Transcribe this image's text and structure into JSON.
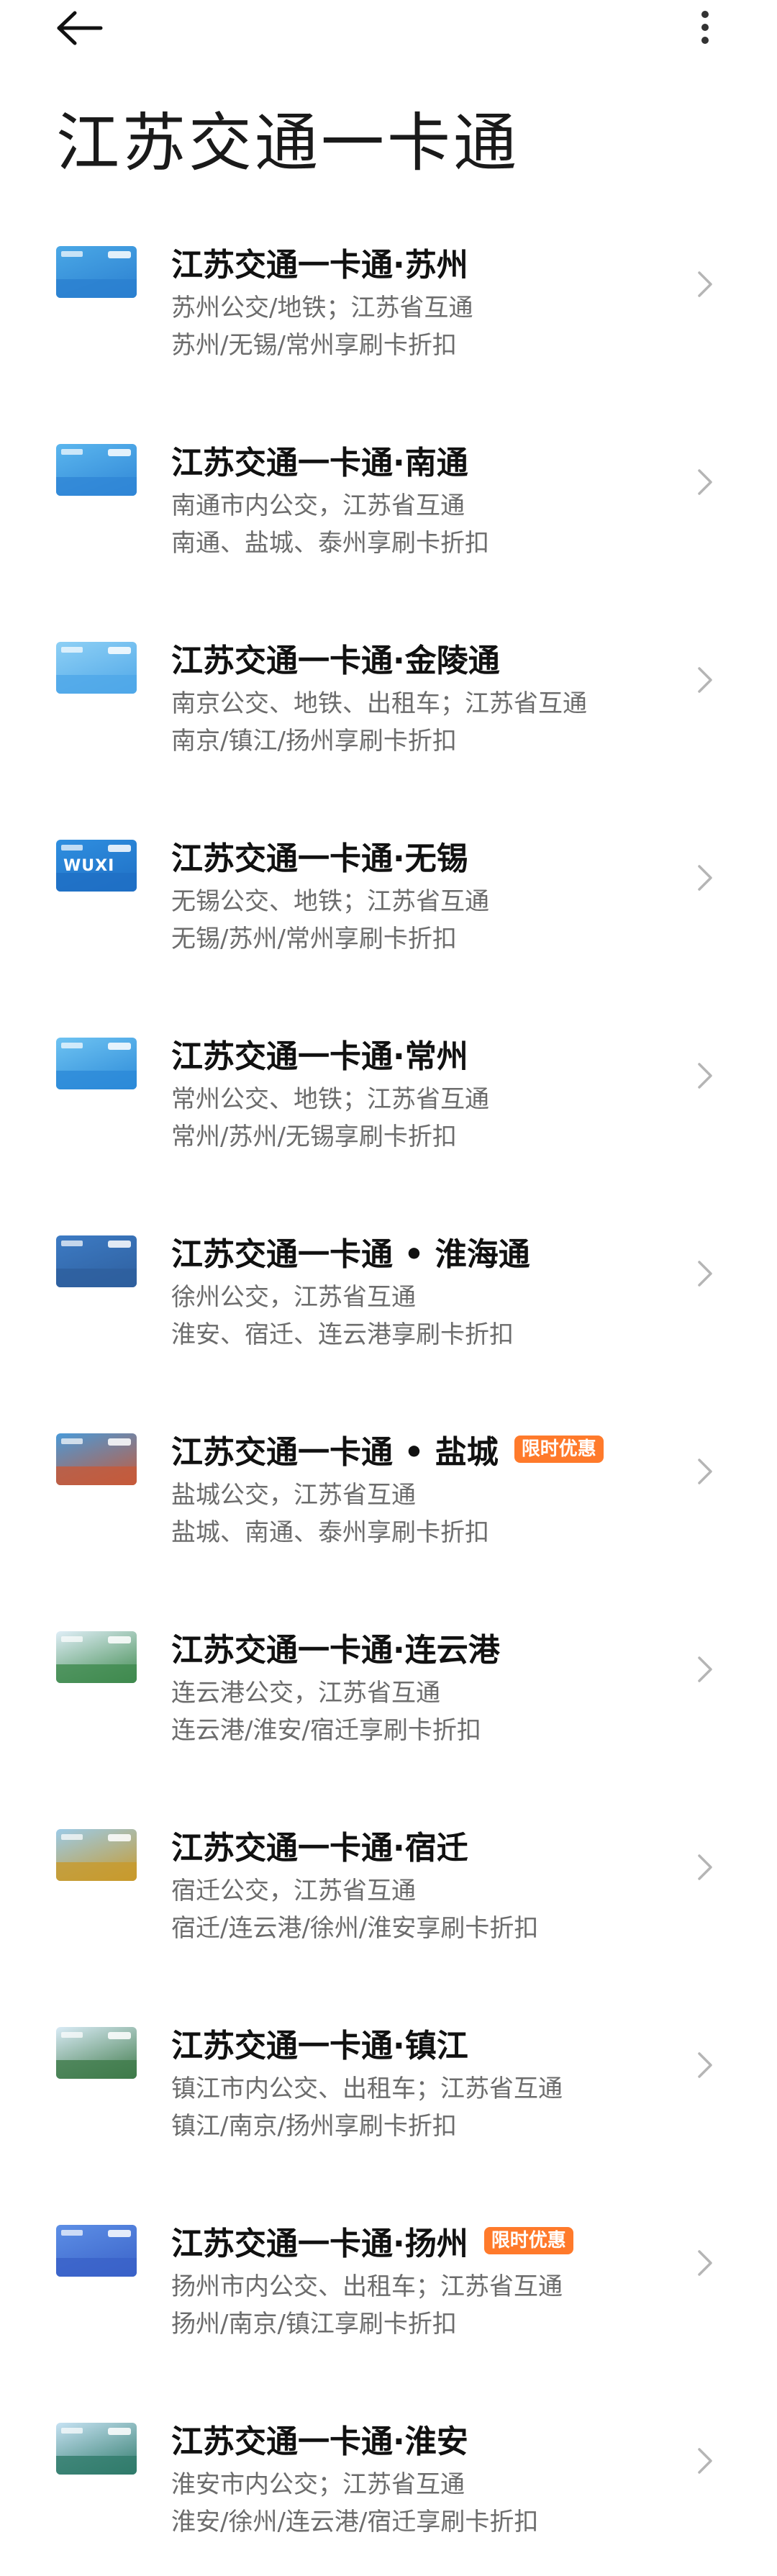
{
  "header": {
    "title": "江苏交通一卡通"
  },
  "cards": [
    {
      "title": "江苏交通一卡通·苏州",
      "line1": "苏州公交/地铁；江苏省互通",
      "line2": "苏州/无锡/常州享刷卡折扣",
      "badge": "",
      "thumb_color": "#4aa8e6",
      "band_color": "#2b7fd0",
      "thumb_text": ""
    },
    {
      "title": "江苏交通一卡通·南通",
      "line1": "南通市内公交，江苏省互通",
      "line2": "南通、盐城、泰州享刷卡折扣",
      "badge": "",
      "thumb_color": "#5bb6ee",
      "band_color": "#2f86d6",
      "thumb_text": ""
    },
    {
      "title": "江苏交通一卡通·金陵通",
      "line1": "南京公交、地铁、出租车；江苏省互通",
      "line2": "南京/镇江/扬州享刷卡折扣",
      "badge": "",
      "thumb_color": "#8ed0f5",
      "band_color": "#4fa7e8",
      "thumb_text": ""
    },
    {
      "title": "江苏交通一卡通·无锡",
      "line1": "无锡公交、地铁；江苏省互通",
      "line2": "无锡/苏州/常州享刷卡折扣",
      "badge": "",
      "thumb_color": "#2f8fe0",
      "band_color": "#1f6fc4",
      "thumb_text": "WUXI"
    },
    {
      "title": "江苏交通一卡通·常州",
      "line1": "常州公交、地铁；江苏省互通",
      "line2": "常州/苏州/无锡享刷卡折扣",
      "badge": "",
      "thumb_color": "#6ec3f2",
      "band_color": "#2c8ad8",
      "thumb_text": ""
    },
    {
      "title": "江苏交通一卡通 • 淮海通",
      "line1": "徐州公交，江苏省互通",
      "line2": "淮安、宿迁、连云港享刷卡折扣",
      "badge": "",
      "thumb_color": "#3d7bc4",
      "band_color": "#2e5f9e",
      "thumb_text": ""
    },
    {
      "title": "江苏交通一卡通 • 盐城",
      "line1": "盐城公交，江苏省互通",
      "line2": "盐城、南通、泰州享刷卡折扣",
      "badge": "限时优惠",
      "thumb_color": "#4a9ad8",
      "band_color": "#c65a3a",
      "thumb_text": ""
    },
    {
      "title": "江苏交通一卡通·连云港",
      "line1": "连云港公交，江苏省互通",
      "line2": "连云港/淮安/宿迁享刷卡折扣",
      "badge": "",
      "thumb_color": "#dfeef7",
      "band_color": "#3f8a4e",
      "thumb_text": ""
    },
    {
      "title": "江苏交通一卡通·宿迁",
      "line1": "宿迁公交，江苏省互通",
      "line2": "宿迁/连云港/徐州/淮安享刷卡折扣",
      "badge": "",
      "thumb_color": "#9ccbe8",
      "band_color": "#c89a2c",
      "thumb_text": ""
    },
    {
      "title": "江苏交通一卡通·镇江",
      "line1": "镇江市内公交、出租车；江苏省互通",
      "line2": "镇江/南京/扬州享刷卡折扣",
      "badge": "",
      "thumb_color": "#d9ebf6",
      "band_color": "#3f7a4a",
      "thumb_text": ""
    },
    {
      "title": "江苏交通一卡通·扬州",
      "line1": "扬州市内公交、出租车；江苏省互通",
      "line2": "扬州/南京/镇江享刷卡折扣",
      "badge": "限时优惠",
      "thumb_color": "#5d8fe6",
      "band_color": "#3a62c8",
      "thumb_text": ""
    },
    {
      "title": "江苏交通一卡通·淮安",
      "line1": "淮安市内公交；江苏省互通",
      "line2": "淮安/徐州/连云港/宿迁享刷卡折扣",
      "badge": "",
      "thumb_color": "#c6e2f3",
      "band_color": "#2f7a6a",
      "thumb_text": ""
    }
  ]
}
